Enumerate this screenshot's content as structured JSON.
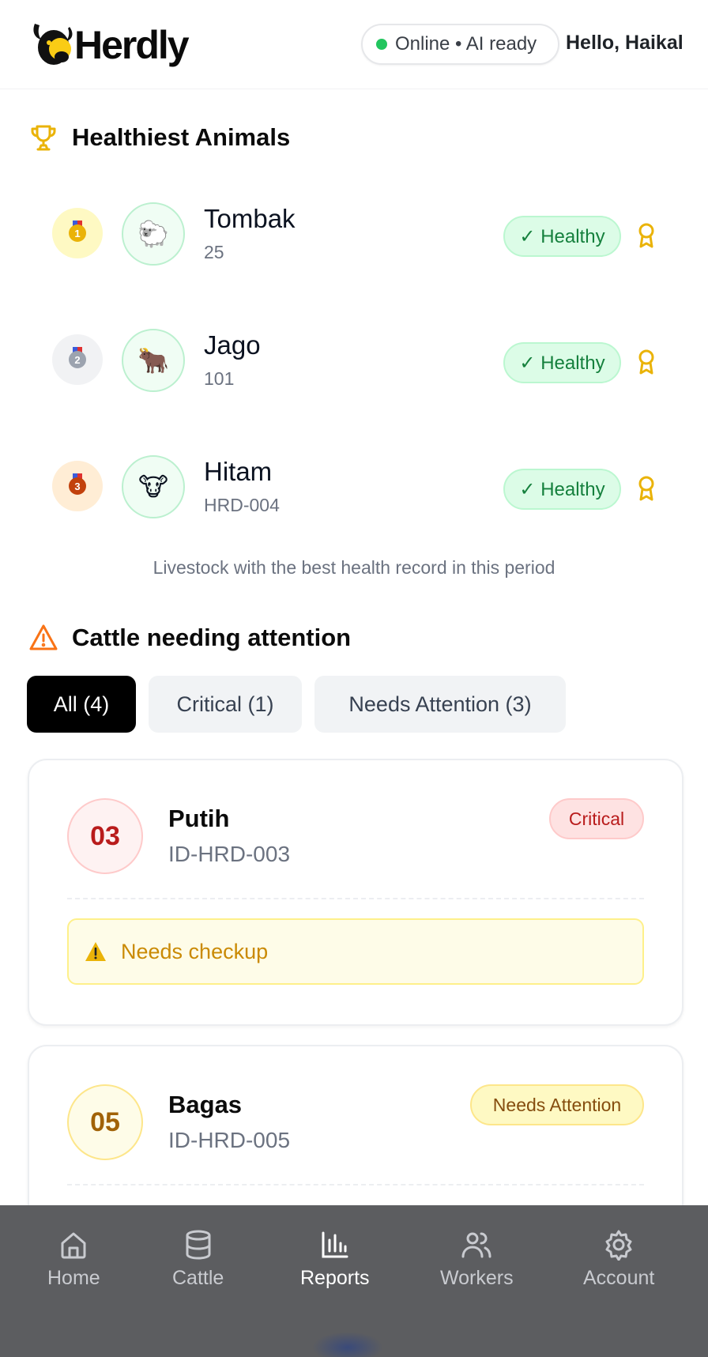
{
  "header": {
    "brand": "Herdly",
    "status": "Online • AI ready",
    "greeting": "Hello, Haikal"
  },
  "healthiest": {
    "title": "Healthiest Animals",
    "caption": "Livestock with the best health record in this period",
    "animals": [
      {
        "rank": "1",
        "name": "Tombak",
        "id": "25",
        "status": "✓ Healthy",
        "emoji": "🐑"
      },
      {
        "rank": "2",
        "name": "Jago",
        "id": "101",
        "status": "✓ Healthy",
        "emoji": "🐂"
      },
      {
        "rank": "3",
        "name": "Hitam",
        "id": "HRD-004",
        "status": "✓ Healthy",
        "emoji": "🐮"
      }
    ]
  },
  "attention": {
    "title": "Cattle needing attention",
    "filters": [
      {
        "label": "All (4)",
        "active": true
      },
      {
        "label": "Critical (1)",
        "active": false
      },
      {
        "label": "Needs Attention (3)",
        "active": false
      }
    ],
    "cards": [
      {
        "number": "03",
        "name": "Putih",
        "id": "ID-HRD-003",
        "severity": "Critical",
        "note": "Needs checkup"
      },
      {
        "number": "05",
        "name": "Bagas",
        "id": "ID-HRD-005",
        "severity": "Needs Attention"
      }
    ]
  },
  "nav": {
    "items": [
      {
        "label": "Home",
        "icon": "home-icon"
      },
      {
        "label": "Cattle",
        "icon": "database-icon"
      },
      {
        "label": "Reports",
        "icon": "bar-chart-icon",
        "active": true
      },
      {
        "label": "Workers",
        "icon": "users-icon"
      },
      {
        "label": "Account",
        "icon": "gear-icon"
      }
    ]
  },
  "colors": {
    "accent": "#000000",
    "healthy": "#15803d",
    "critical": "#b91c1c",
    "warning": "#ca8a04"
  }
}
